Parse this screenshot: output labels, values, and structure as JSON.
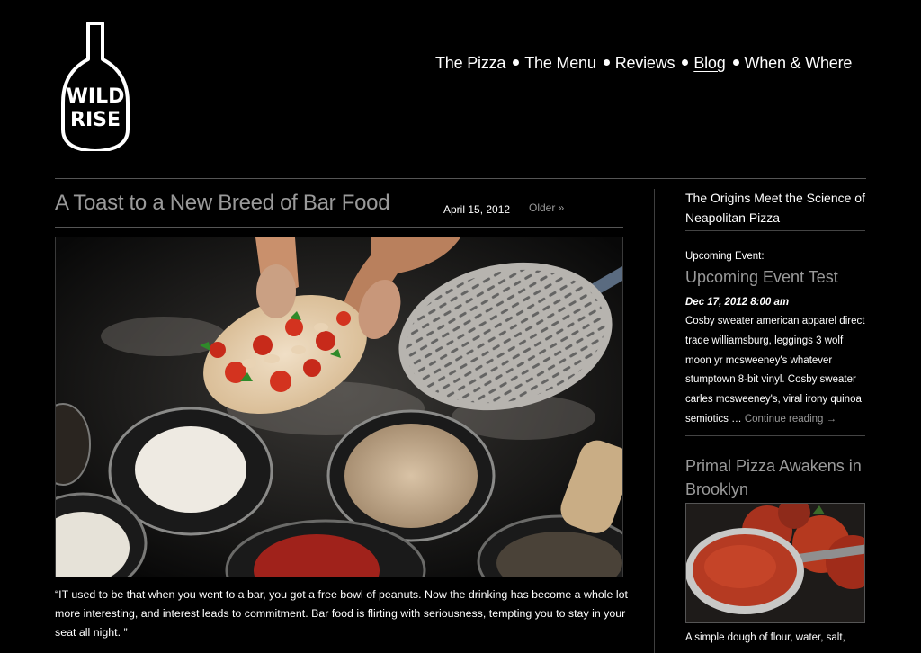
{
  "brand": {
    "logo_line1": "WILD",
    "logo_line2": "RISE"
  },
  "nav": {
    "items": [
      {
        "label": "The Pizza"
      },
      {
        "label": "The Menu"
      },
      {
        "label": "Reviews"
      },
      {
        "label": "Blog",
        "active": true
      },
      {
        "label": "When & Where"
      }
    ]
  },
  "post": {
    "title": "A Toast to a New Breed of Bar Food",
    "date": "April 15, 2012",
    "older_label": "Older »",
    "quote": "“IT used to be that when you went to a bar, you got a free bowl of peanuts. Now the drinking has become a whole lot more interesting, and interest leads to commitment. Bar food is flirting with seriousness, tempting you to stay in your seat all night. ”"
  },
  "sidebar": {
    "heading": "The Origins Meet the Science of Neapolitan Pizza",
    "upcoming_label": "Upcoming Event:",
    "event_title": "Upcoming Event Test",
    "event_date": "Dec 17, 2012 8:00 am",
    "event_desc": "Cosby sweater american apparel direct trade williamsburg, leggings 3 wolf moon yr mcsweeney's whatever stumptown 8-bit vinyl. Cosby sweater carles mcsweeney's, viral irony quinoa semiotics … ",
    "continue_label": "Continue reading →",
    "post_title": "Primal Pizza Awakens in Brooklyn",
    "post_caption": "A simple dough of flour, water, salt,"
  },
  "colors": {
    "background": "#000000",
    "muted_text": "#9a9a9a",
    "divider": "#555555"
  }
}
